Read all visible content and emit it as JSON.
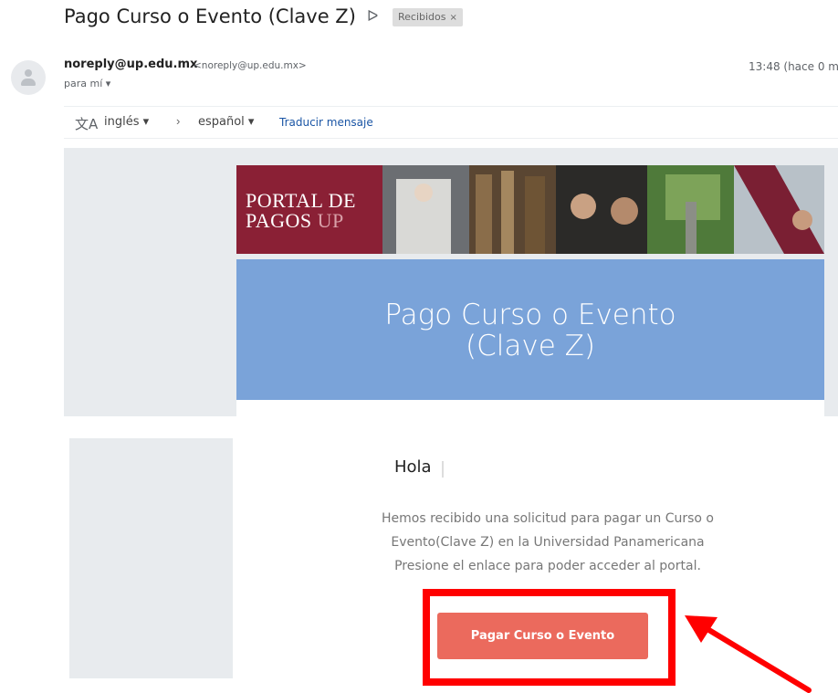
{
  "email": {
    "subject": "Pago Curso o Evento (Clave Z)",
    "important_icon": "importance-marker-icon",
    "label": "Recibidos",
    "label_close": "×",
    "sender_name": "noreply@up.edu.mx",
    "sender_email": "<noreply@up.edu.mx>",
    "to_line": "para mí ▾",
    "time": "13:48 (hace 0 m"
  },
  "translate": {
    "icon": "translate-icon",
    "from": "inglés ▾",
    "arrow": "›",
    "to": "español ▾",
    "link": "Traducir mensaje"
  },
  "body": {
    "logo_line1": "PORTAL DE",
    "logo_line2_main": "PAGOS ",
    "logo_line2_accent": "UP",
    "hero_line1": "Pago Curso o Evento",
    "hero_line2": "(Clave Z)",
    "greeting": "Hola",
    "message_line1": "Hemos recibido una solicitud para pagar un Curso o",
    "message_line2": "Evento(Clave Z) en la Universidad Panamericana",
    "message_line3": "Presione el enlace para poder acceder al portal.",
    "button_label": "Pagar Curso o Evento"
  },
  "colors": {
    "hero_blue": "#7aa3d9",
    "brand_maroon": "#8a2035",
    "button": "#eb6a5d",
    "highlight": "#ff0000"
  }
}
